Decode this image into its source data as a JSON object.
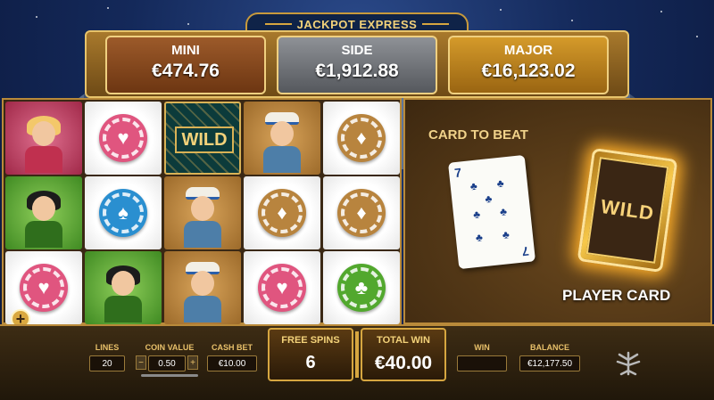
{
  "header": {
    "title": "JACKPOT EXPRESS"
  },
  "jackpots": {
    "mini_label": "MINI",
    "mini_value": "€474.76",
    "side_label": "SIDE",
    "side_value": "€1,912.88",
    "major_label": "MAJOR",
    "major_value": "€16,123.02"
  },
  "reels": {
    "symbols": [
      [
        "showgirl-blonde",
        "showgirl-dark",
        "pink-heart-chip"
      ],
      [
        "pink-heart-chip",
        "blue-spade-chip",
        "showgirl-dark"
      ],
      [
        "wild",
        "conductor",
        "conductor"
      ],
      [
        "conductor",
        "bronze-diamond-chip",
        "pink-heart-chip"
      ],
      [
        "bronze-diamond-chip",
        "bronze-diamond-chip",
        "green-club-chip"
      ]
    ],
    "wild_label": "WILD",
    "plus_button": "+"
  },
  "side_game": {
    "card_to_beat_label": "CARD TO BEAT",
    "card_rank": "7",
    "card_suit": "clubs",
    "player_card_label": "PLAYER CARD",
    "player_card_back_text": "WILD"
  },
  "controls": {
    "lines_label": "LINES",
    "lines_value": "20",
    "coin_value_label": "COIN VALUE",
    "coin_value": "0.50",
    "minus": "−",
    "plus": "+",
    "cash_bet_label": "CASH BET",
    "cash_bet_value": "€10.00",
    "free_spins_label": "FREE SPINS",
    "free_spins_value": "6",
    "total_win_label": "TOTAL WIN",
    "total_win_value": "€40.00",
    "win_label": "WIN",
    "win_value": "",
    "balance_label": "BALANCE",
    "balance_value": "€12,177.50"
  },
  "colors": {
    "gold": "#d6a640",
    "panel_brown": "#3d2810",
    "sky_blue": "#14295a"
  }
}
